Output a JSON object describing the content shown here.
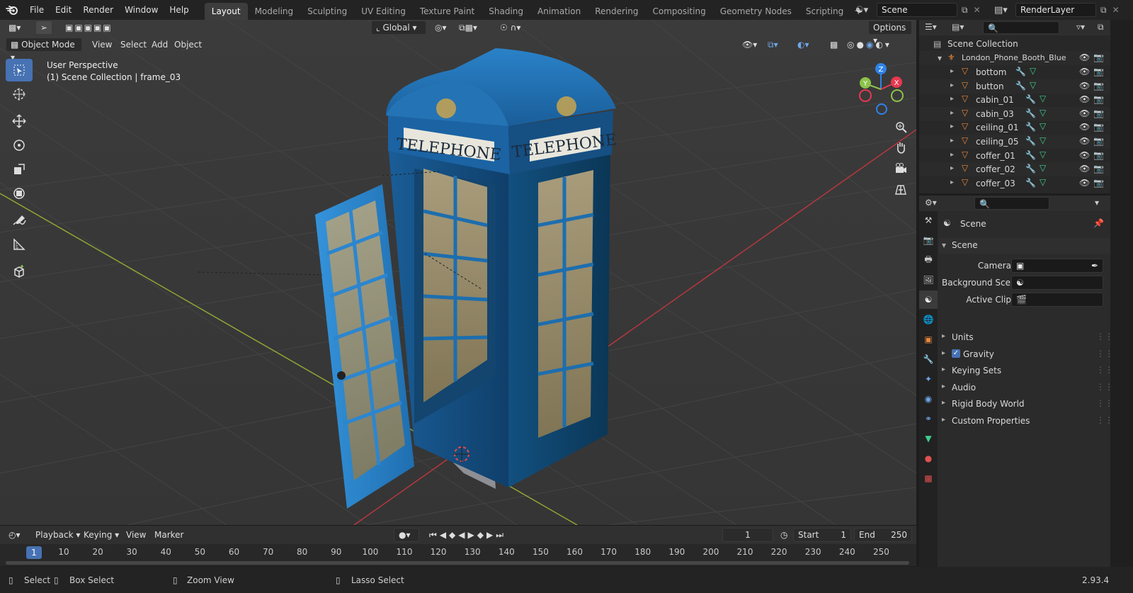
{
  "topbar": {
    "menus": [
      "File",
      "Edit",
      "Render",
      "Window",
      "Help"
    ],
    "workspaces": [
      "Layout",
      "Modeling",
      "Sculpting",
      "UV Editing",
      "Texture Paint",
      "Shading",
      "Animation",
      "Rendering",
      "Compositing",
      "Geometry Nodes",
      "Scripting"
    ],
    "active_workspace": "Layout",
    "scene_name": "Scene",
    "view_layer": "RenderLayer"
  },
  "viewport": {
    "mode": "Object Mode",
    "menus": [
      "View",
      "Select",
      "Add",
      "Object"
    ],
    "orientation": "Global",
    "options_label": "Options",
    "info_line1": "User Perspective",
    "info_line2": "(1) Scene Collection | frame_03",
    "booth_sign_left": "TELEPHONE",
    "booth_sign_right": "TELEPHONE",
    "gizmo_axes": [
      "X",
      "Y",
      "Z"
    ]
  },
  "timeline": {
    "menus": [
      "Playback",
      "Keying",
      "View",
      "Marker"
    ],
    "current_frame": "1",
    "start_label": "Start",
    "start_value": "1",
    "end_label": "End",
    "end_value": "250",
    "ticks": [
      "10",
      "20",
      "30",
      "40",
      "50",
      "60",
      "70",
      "80",
      "90",
      "100",
      "110",
      "120",
      "130",
      "140",
      "150",
      "160",
      "170",
      "180",
      "190",
      "200",
      "210",
      "220",
      "230",
      "240",
      "250"
    ]
  },
  "statusbar": {
    "select": "Select",
    "box_select": "Box Select",
    "zoom_view": "Zoom View",
    "lasso_select": "Lasso Select",
    "version": "2.93.4"
  },
  "outliner": {
    "root": "Scene Collection",
    "collection": "London_Phone_Booth_Blue",
    "objects": [
      "bottom",
      "button",
      "cabin_01",
      "cabin_03",
      "ceiling_01",
      "ceiling_05",
      "coffer_01",
      "coffer_02",
      "coffer_03"
    ]
  },
  "properties": {
    "context": "Scene",
    "panel_title": "Scene",
    "fields": {
      "camera": "Camera",
      "background_scene": "Background Sce...",
      "active_clip": "Active Clip"
    },
    "collapsed_panels": [
      "Units",
      "Gravity",
      "Keying Sets",
      "Audio",
      "Rigid Body World",
      "Custom Properties"
    ],
    "gravity_checked": true
  },
  "colors": {
    "accent": "#4772b3",
    "viewport_bg": "#393939",
    "booth_blue": "#1f6fb0",
    "object_icon": "#e8873a",
    "axis_x": "#e8384f",
    "axis_y": "#8bc34a",
    "axis_z": "#2f83e8"
  }
}
